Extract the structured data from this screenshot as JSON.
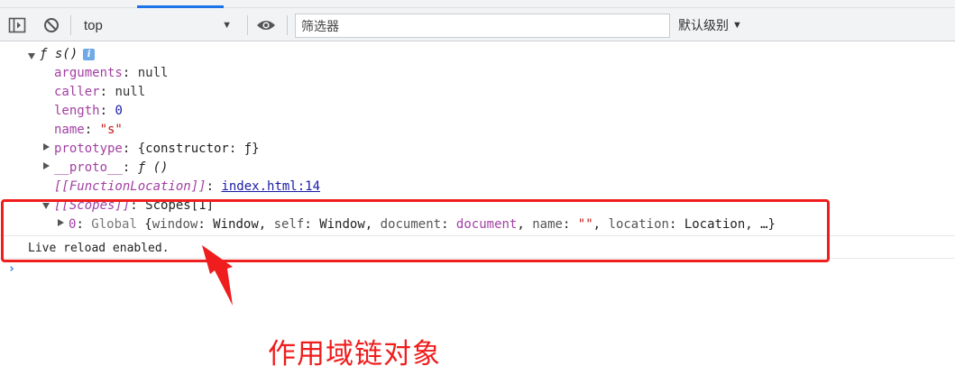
{
  "toolbar": {
    "context": "top",
    "filter_placeholder": "筛选器",
    "level_label": "默认级别",
    "icons": [
      "sidebar-toggle-icon",
      "clear-console-icon",
      "eye-icon",
      "chevron-down-icon"
    ]
  },
  "console": {
    "function_header": {
      "symbol": "ƒ",
      "name": "s()",
      "badge": "i"
    },
    "props": [
      {
        "key": "arguments",
        "sep": ": ",
        "value": "null"
      },
      {
        "key": "caller",
        "sep": ": ",
        "value": "null"
      },
      {
        "key": "length",
        "sep": ": ",
        "value": "0"
      },
      {
        "key": "name",
        "sep": ": ",
        "value": "\"s\""
      }
    ],
    "prototype": {
      "key": "prototype",
      "sep": ": ",
      "value": "{constructor: ƒ}"
    },
    "proto": {
      "key": "__proto__",
      "sep": ": ",
      "value": "ƒ ()"
    },
    "function_location": {
      "key": "[[FunctionLocation]]",
      "sep": ": ",
      "value": "index.html:14"
    },
    "scopes": {
      "key": "[[Scopes]]",
      "sep": ": ",
      "value": "Scopes[1]"
    },
    "scope_entry": {
      "index": "0",
      "sep": ": ",
      "label": "Global",
      "open": " {",
      "p1_key": "window",
      "p1_val": "Window",
      "p2_key": "self",
      "p2_val": "Window",
      "p3_key": "document",
      "p3_val": "document",
      "p4_key": "name",
      "p4_val": "\"\"",
      "p5_key": "location",
      "p5_val": "Location",
      "tail": "…}"
    },
    "log_message": "Live reload enabled.",
    "prompt": "›"
  },
  "annotation": {
    "text": "作用域链对象",
    "color": "#ef1d1d"
  }
}
